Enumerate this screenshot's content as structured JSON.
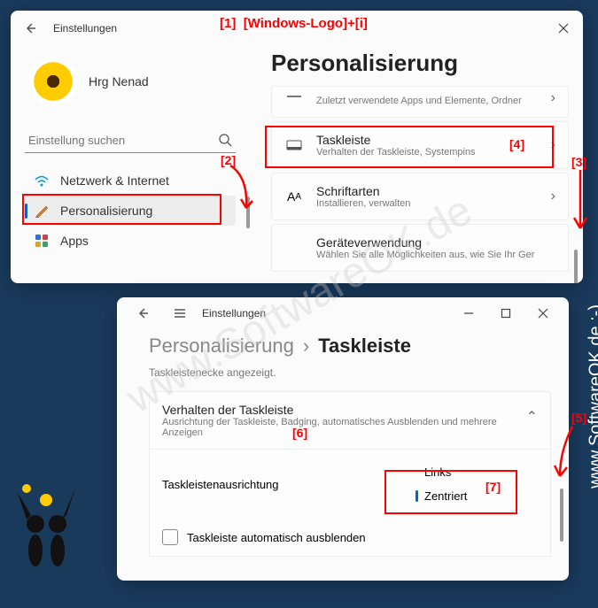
{
  "annotations": {
    "shortcut_hint": "[Windows-Logo]+[i]",
    "n1": "[1]",
    "n2": "[2]",
    "n3": "[3]",
    "n4": "[4]",
    "n5": "[5]",
    "n6": "[6]",
    "n7": "[7]"
  },
  "watermark": {
    "diagonal": "www.SoftwareOK.de",
    "side": "www.SoftwareOK.de :-)"
  },
  "window1": {
    "title": "Einstellungen",
    "username": "Hrg Nenad",
    "search_placeholder": "Einstellung suchen",
    "page_title": "Personalisierung",
    "nav": {
      "network": "Netzwerk & Internet",
      "personalization": "Personalisierung",
      "apps": "Apps"
    },
    "cards": {
      "recent_desc": "Zuletzt verwendete Apps und Elemente, Ordner",
      "taskbar": {
        "title": "Taskleiste",
        "desc": "Verhalten der Taskleiste, Systempins"
      },
      "fonts": {
        "title": "Schriftarten",
        "desc": "Installieren, verwalten"
      },
      "usage": {
        "title": "Geräteverwendung",
        "desc": "Wählen Sie alle Möglichkeiten aus, wie Sie Ihr Ger"
      }
    }
  },
  "window2": {
    "title": "Einstellungen",
    "breadcrumb": {
      "parent": "Personalisierung",
      "current": "Taskleiste"
    },
    "status": "Taskleistenecke angezeigt.",
    "section": {
      "title": "Verhalten der Taskleiste",
      "desc": "Ausrichtung der Taskleiste, Badging, automatisches Ausblenden und mehrere Anzeigen"
    },
    "alignment": {
      "label": "Taskleistenausrichtung",
      "opt_left": "Links",
      "opt_center": "Zentriert"
    },
    "autohide": "Taskleiste automatisch ausblenden"
  }
}
